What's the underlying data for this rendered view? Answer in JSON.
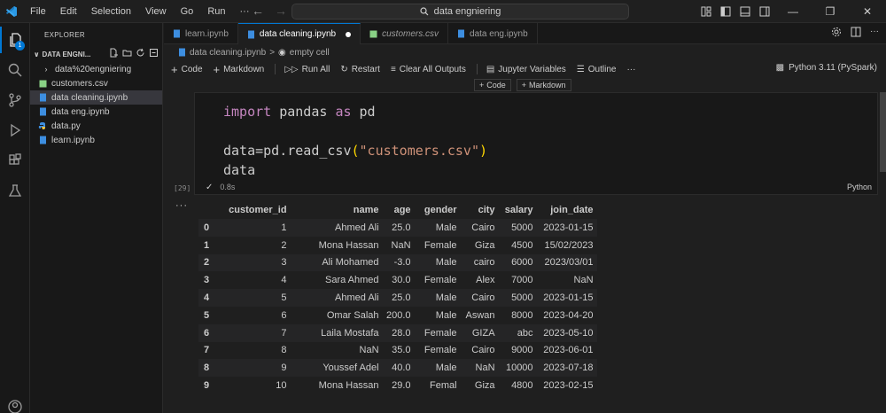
{
  "titlebar": {
    "menu": [
      "File",
      "Edit",
      "Selection",
      "View",
      "Go",
      "Run",
      "···"
    ],
    "search_text": "data engniering"
  },
  "activity": {
    "explorer_badge": "1"
  },
  "sidebar": {
    "title": "EXPLORER",
    "folder": "DATA ENGNI...",
    "items": [
      {
        "label": "data%20engniering",
        "type": "folder"
      },
      {
        "label": "customers.csv",
        "type": "csv"
      },
      {
        "label": "data cleaning.ipynb",
        "type": "notebook"
      },
      {
        "label": "data eng.ipynb",
        "type": "notebook"
      },
      {
        "label": "data.py",
        "type": "python"
      },
      {
        "label": "learn.ipynb",
        "type": "notebook"
      }
    ]
  },
  "tabs": [
    {
      "label": "learn.ipynb",
      "type": "notebook"
    },
    {
      "label": "data cleaning.ipynb",
      "type": "notebook"
    },
    {
      "label": "customers.csv",
      "type": "csv"
    },
    {
      "label": "data eng.ipynb",
      "type": "notebook"
    }
  ],
  "breadcrumb": {
    "file": "data cleaning.ipynb",
    "sep": ">",
    "cell": "empty cell"
  },
  "toolbar": {
    "code": "Code",
    "markdown": "Markdown",
    "run_all": "Run All",
    "restart": "Restart",
    "clear_all": "Clear All Outputs",
    "variables": "Jupyter Variables",
    "outline": "Outline",
    "more": "···",
    "kernel": "Python 3.11 (PySpark)"
  },
  "insert": {
    "code": "Code",
    "markdown": "Markdown"
  },
  "cell": {
    "line1_kw1": "import",
    "line1_mid": " pandas ",
    "line1_kw2": "as",
    "line1_end": " pd",
    "line2_start": "data=pd.read_csv",
    "line2_open": "(",
    "line2_str": "\"customers.csv\"",
    "line2_close": ")",
    "line3": "data",
    "exec_count": "[29]",
    "time": "0.8s",
    "language": "Python"
  },
  "output": {
    "dots": "···",
    "columns": [
      "",
      "customer_id",
      "name",
      "age",
      "gender",
      "city",
      "salary",
      "join_date"
    ],
    "rows": [
      [
        "0",
        "1",
        "Ahmed Ali",
        "25.0",
        "Male",
        "Cairo",
        "5000",
        "2023-01-15"
      ],
      [
        "1",
        "2",
        "Mona Hassan",
        "NaN",
        "Female",
        "Giza",
        "4500",
        "15/02/2023"
      ],
      [
        "2",
        "3",
        "Ali Mohamed",
        "-3.0",
        "Male",
        "cairo",
        "6000",
        "2023/03/01"
      ],
      [
        "3",
        "4",
        "Sara Ahmed",
        "30.0",
        "Female",
        "Alex",
        "7000",
        "NaN"
      ],
      [
        "4",
        "5",
        "Ahmed Ali",
        "25.0",
        "Male",
        "Cairo",
        "5000",
        "2023-01-15"
      ],
      [
        "5",
        "6",
        "Omar Salah",
        "200.0",
        "Male",
        "Aswan",
        "8000",
        "2023-04-20"
      ],
      [
        "6",
        "7",
        "Laila Mostafa",
        "28.0",
        "Female",
        "GIZA",
        "abc",
        "2023-05-10"
      ],
      [
        "7",
        "8",
        "NaN",
        "35.0",
        "Female",
        "Cairo",
        "9000",
        "2023-06-01"
      ],
      [
        "8",
        "9",
        "Youssef Adel",
        "40.0",
        "Male",
        "NaN",
        "10000",
        "2023-07-18"
      ],
      [
        "9",
        "10",
        "Mona Hassan",
        "29.0",
        "Femal",
        "Giza",
        "4800",
        "2023-02-15"
      ]
    ]
  },
  "colors": {
    "accent": "#0078d4",
    "keyword": "#c586c0",
    "string": "#ce9178"
  }
}
